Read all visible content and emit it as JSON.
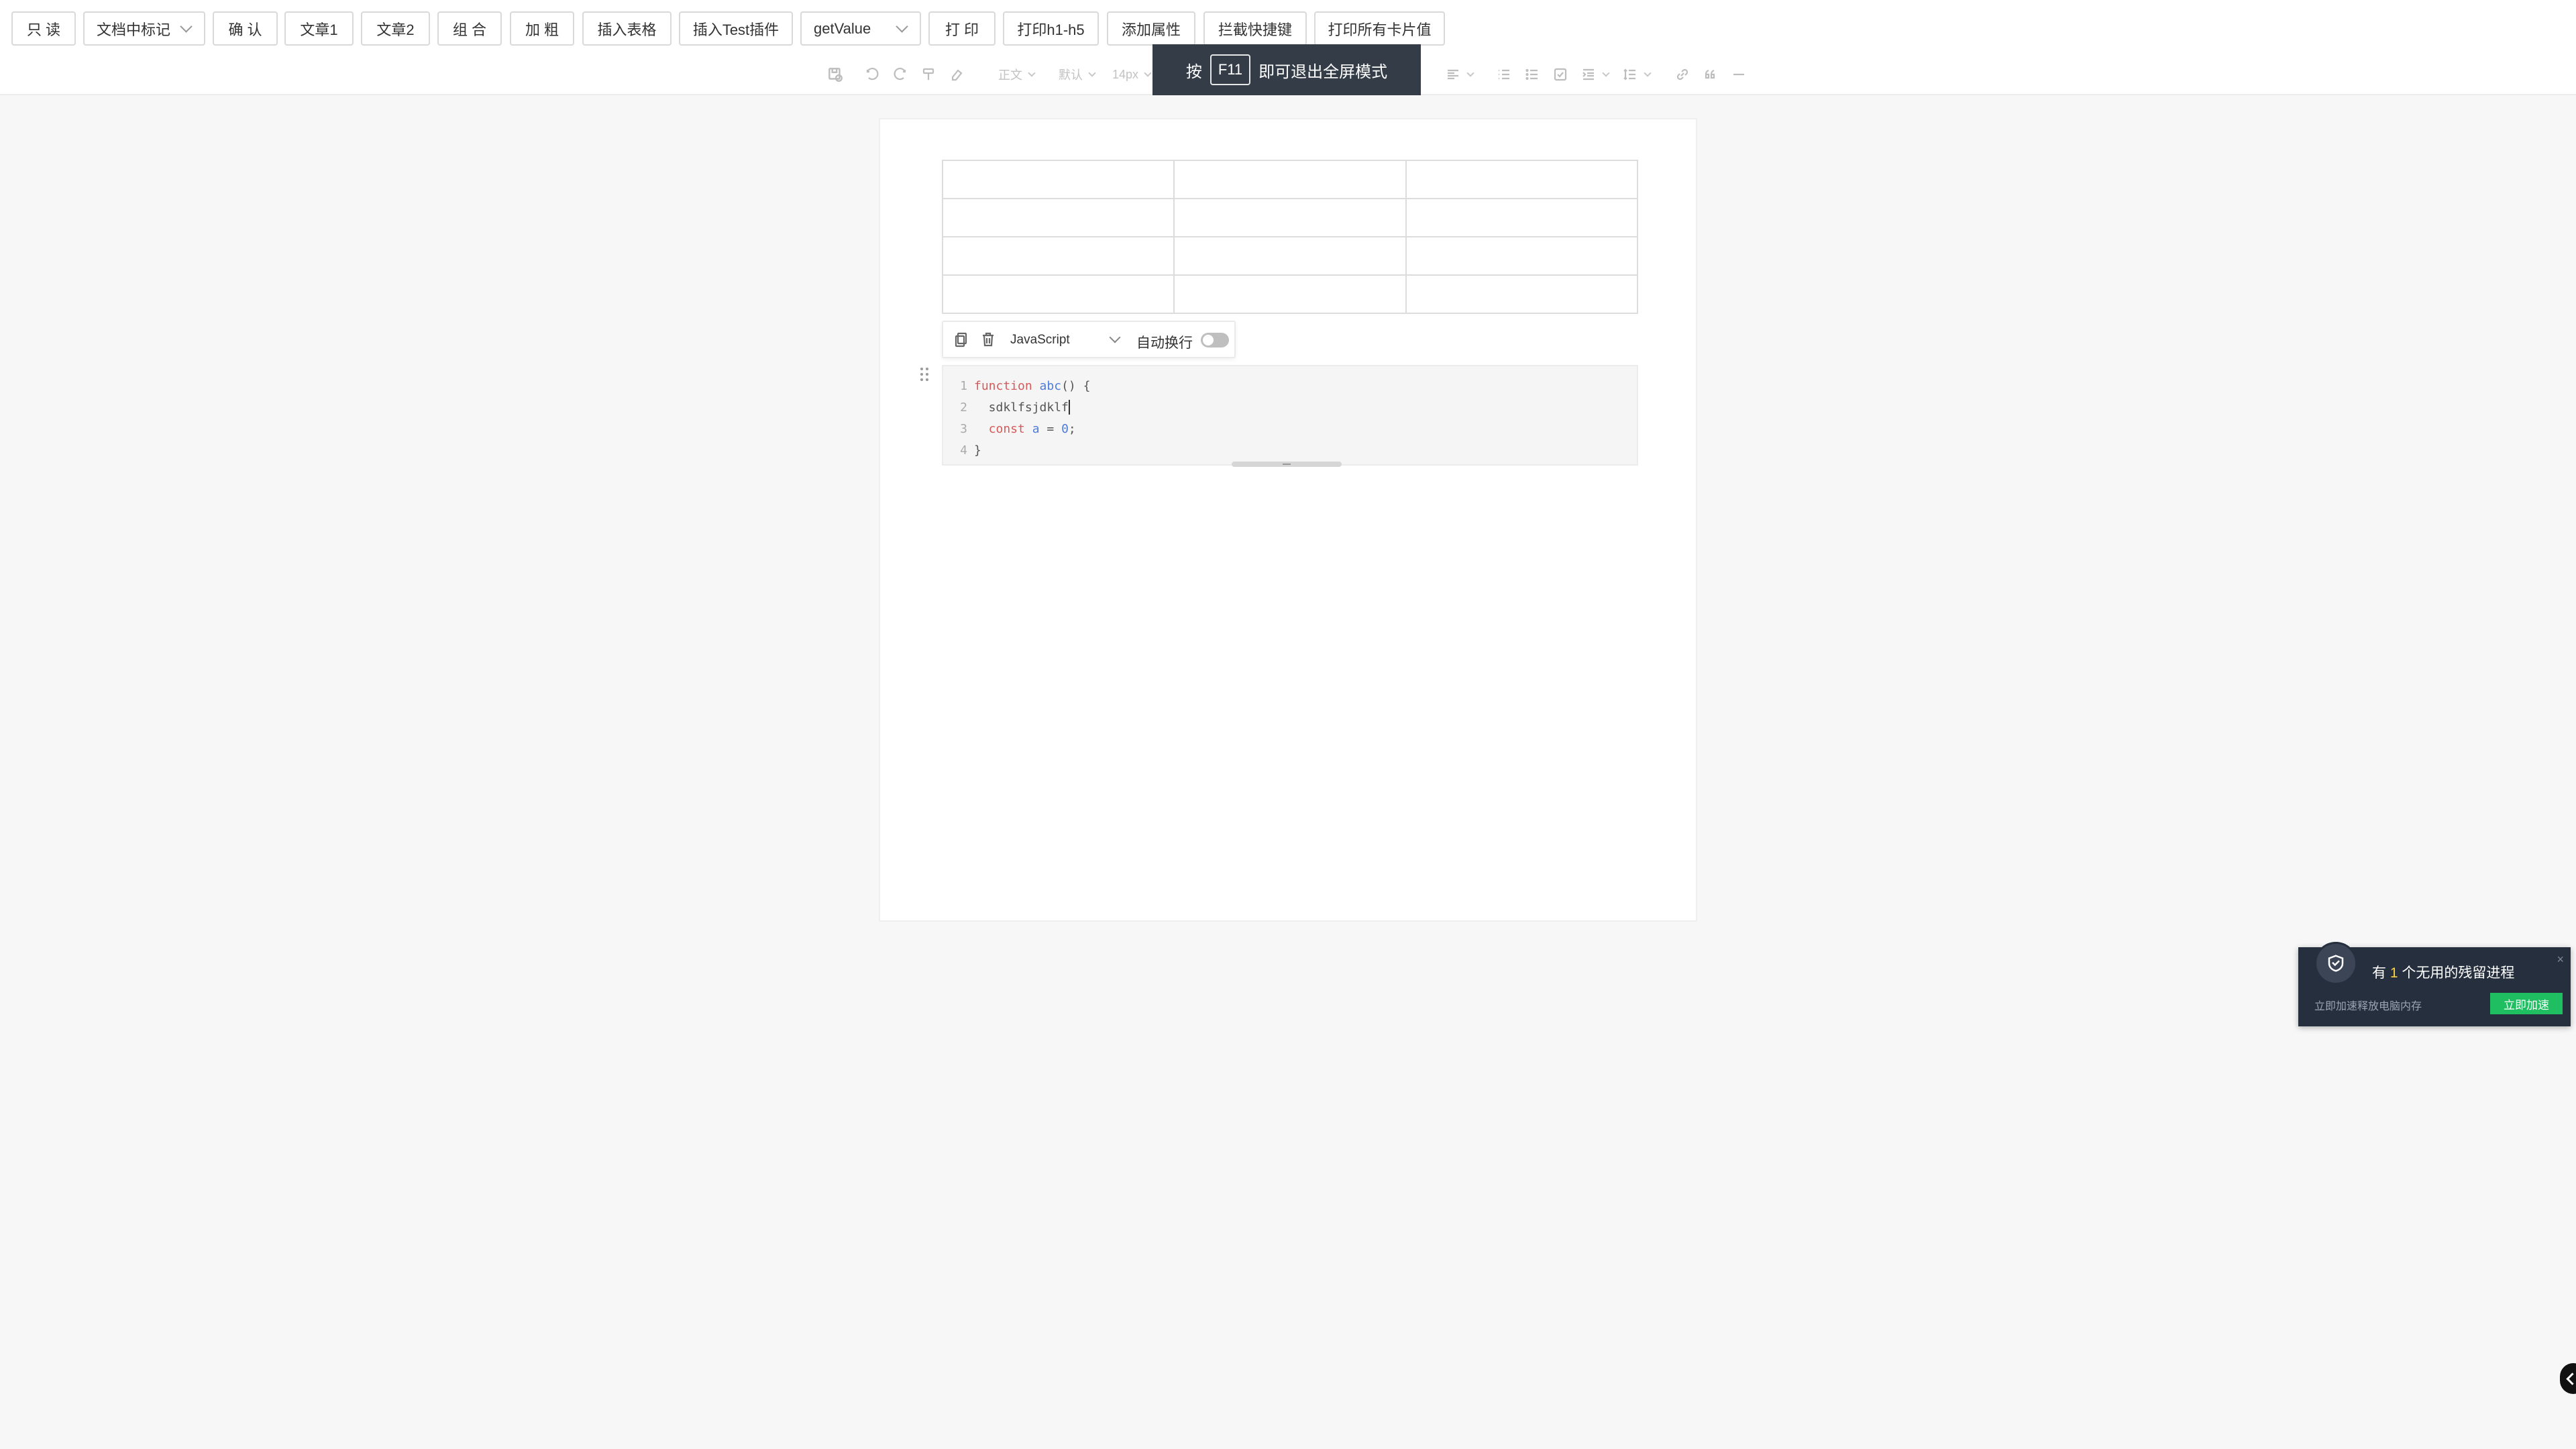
{
  "topbar": {
    "buttons": [
      "只 读",
      "文档中标记",
      "确 认",
      "文章1",
      "文章2",
      "组 合",
      "加 粗",
      "插入表格",
      "插入Test插件",
      "getValue",
      "打 印",
      "打印h1-h5",
      "添加属性",
      "拦截快捷键",
      "打印所有卡片值"
    ]
  },
  "toolbar": {
    "paragraph": "正文",
    "font": "默认",
    "font_size": "14px"
  },
  "fullscreen_tip": {
    "prefix": "按",
    "key": "F11",
    "suffix": "即可退出全屏模式"
  },
  "codeblock": {
    "language": "JavaScript",
    "wrap_label": "自动换行",
    "wrap_enabled": false,
    "lines": [
      {
        "n": "1",
        "parts": [
          [
            "kw",
            "function "
          ],
          [
            "fn",
            "abc"
          ],
          [
            "pl",
            "() {"
          ]
        ]
      },
      {
        "n": "2",
        "parts": [
          [
            "pl",
            "  sdklfsjdklf"
          ]
        ]
      },
      {
        "n": "3",
        "parts": [
          [
            "kw",
            "  const "
          ],
          [
            "fn",
            "a"
          ],
          [
            "pl",
            " = "
          ],
          [
            "num",
            "0"
          ],
          [
            "pl",
            ";"
          ]
        ]
      },
      {
        "n": "4",
        "parts": [
          [
            "pl",
            "}"
          ]
        ]
      }
    ]
  },
  "notification": {
    "title_prefix": "有 ",
    "count": "1",
    "title_suffix": " 个无用的残留进程",
    "subtitle": "立即加速释放电脑内存",
    "action": "立即加速",
    "close": "×"
  },
  "colors": {
    "notification_bg": "#262f3e",
    "accent_green": "#1fbf61",
    "tip_bg": "#333c47"
  }
}
